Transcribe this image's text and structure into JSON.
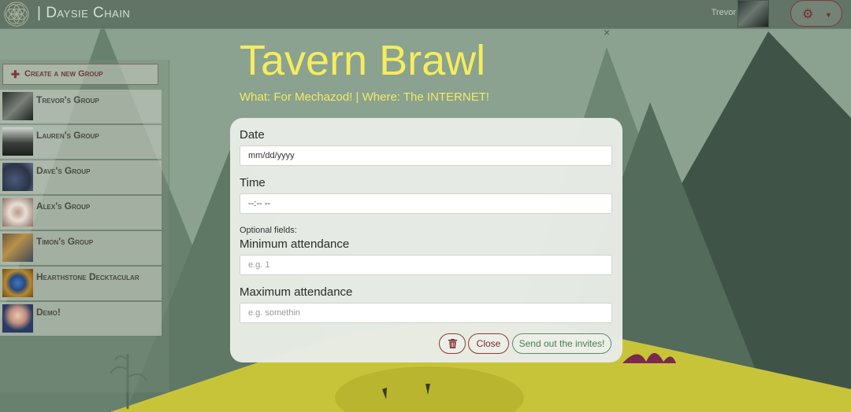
{
  "nav": {
    "brand": "| Daysie Chain",
    "user_name": "Trevor",
    "settings_icon": "gear-icon",
    "settings_caret_icon": "caret-down-icon"
  },
  "sidebar": {
    "create_button": {
      "icon": "plus-icon",
      "label": "Create a new Group"
    },
    "groups": [
      {
        "name": "Trevor's Group"
      },
      {
        "name": "Lauren's Group"
      },
      {
        "name": "Dave's Group"
      },
      {
        "name": "Alex's Group"
      },
      {
        "name": "Timon's Group"
      },
      {
        "name": "Hearthstone Decktacular"
      },
      {
        "name": "Demo!"
      }
    ]
  },
  "event": {
    "title": "Tavern Brawl",
    "subtitle": "What: For Mechazod! | Where: The INTERNET!",
    "close_icon": "close-icon"
  },
  "form": {
    "date_label": "Date",
    "date_value": "mm/dd/yyyy",
    "time_label": "Time",
    "time_value": "--:-- --",
    "optional_note": "Optional fields:",
    "min_label": "Minimum attendance",
    "min_placeholder": "e.g. 1",
    "max_label": "Maximum attendance",
    "max_placeholder": "e.g. somethin",
    "delete_icon": "trash-icon",
    "close_label": "Close",
    "send_label": "Send out the invites!"
  },
  "colors": {
    "title": "#f5ec5e",
    "accent_red": "#7a2a2a",
    "accent_green": "#4a7a5a"
  }
}
